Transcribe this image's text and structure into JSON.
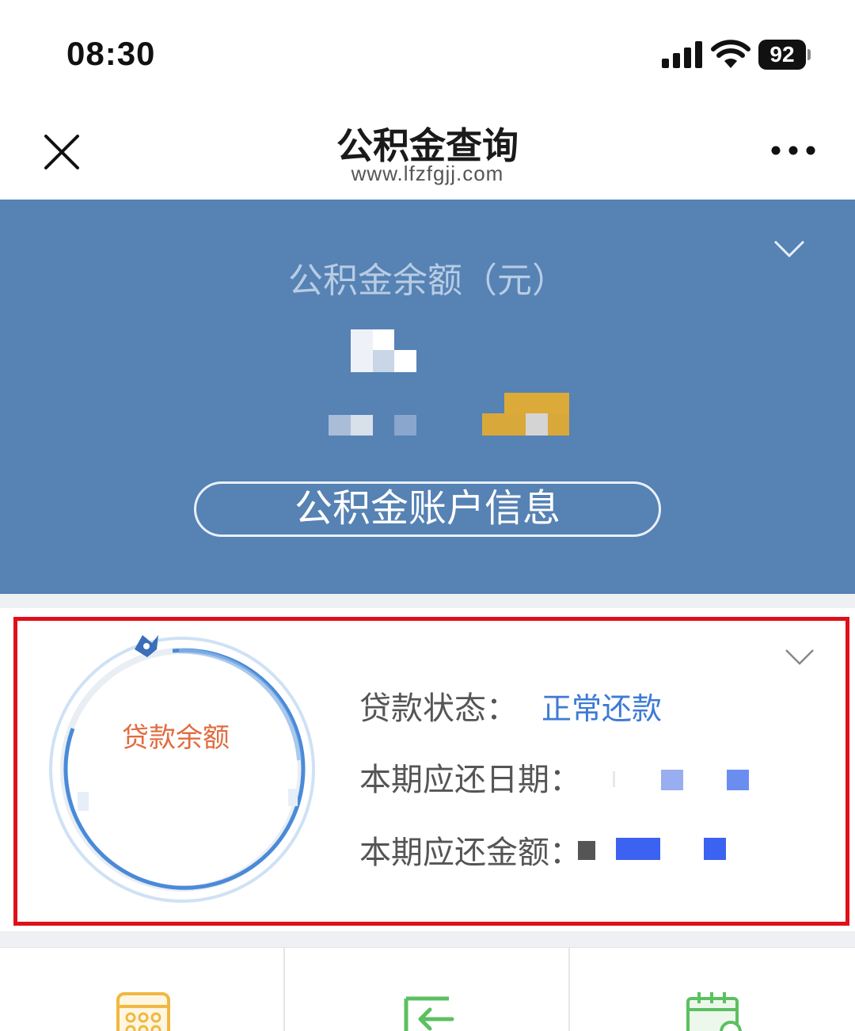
{
  "status_bar": {
    "time": "08:30",
    "battery": "92",
    "icons": [
      "cellular-signal-icon",
      "wifi-icon",
      "battery-icon"
    ]
  },
  "nav": {
    "title": "公积金查询",
    "subtitle": "www.lfzfgjj.com",
    "icons": [
      "close-icon",
      "more-icon"
    ]
  },
  "balance_panel": {
    "label": "公积金余额（元）",
    "account_button": "公积金账户信息",
    "colors": {
      "background": "#5682b4",
      "label": "#b8cce4",
      "accent": "#e0b030"
    }
  },
  "loan_card": {
    "ring_label": "贷款余额",
    "status_label": "贷款状态：",
    "status_value": "正常还款",
    "due_date_label": "本期应还日期：",
    "due_amount_label": "本期应还金额：",
    "colors": {
      "highlight_border": "#e0101a",
      "status_value": "#3d7ad6",
      "ring_label": "#e06c40",
      "ring": "#4a8ad8"
    }
  },
  "bottom_grid": {
    "icons": [
      "calendar-icon",
      "transfer-in-icon",
      "schedule-icon"
    ],
    "colors": [
      "#f0b840",
      "#5cc060",
      "#5cc060"
    ]
  }
}
